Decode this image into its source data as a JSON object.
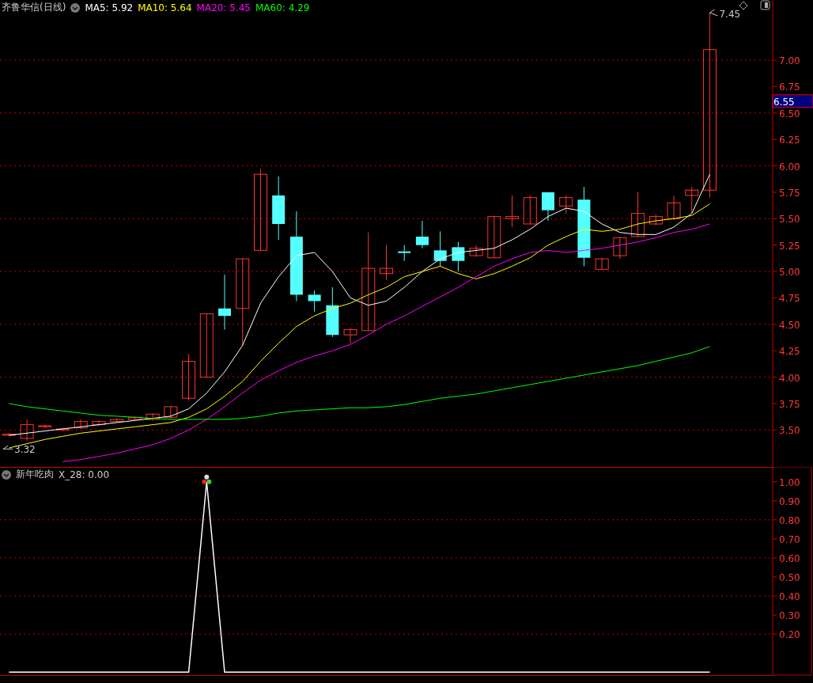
{
  "header": {
    "title": "齐鲁华信(日线)",
    "indicators": [
      {
        "label": "MA5: 5.92"
      },
      {
        "label": "MA10: 5.64"
      },
      {
        "label": "MA20: 5.45"
      },
      {
        "label": "MA60: 4.29"
      }
    ]
  },
  "price_chart": {
    "high_label": "7.45",
    "low_label": "3.32",
    "current_price": "6.55",
    "chart_data": {
      "type": "candlestick",
      "grid": true,
      "ylim": [
        3.15,
        7.57
      ],
      "categories": [
        null,
        null,
        null,
        null,
        null,
        null,
        null,
        null,
        null,
        null,
        null,
        null,
        null,
        null,
        null,
        null,
        null,
        null,
        null,
        null,
        null,
        null,
        null,
        null,
        null,
        null,
        null,
        null,
        null,
        null,
        null,
        null,
        null,
        null,
        null,
        null,
        null,
        null,
        null,
        null,
        null,
        null,
        null
      ],
      "ohlc": [
        [
          3.45,
          3.47,
          3.44,
          3.46
        ],
        [
          3.42,
          3.6,
          3.4,
          3.55
        ],
        [
          3.53,
          3.55,
          3.52,
          3.54
        ],
        [
          3.5,
          3.52,
          3.49,
          3.51
        ],
        [
          3.52,
          3.6,
          3.51,
          3.58
        ],
        [
          3.55,
          3.59,
          3.54,
          3.58
        ],
        [
          3.58,
          3.61,
          3.57,
          3.6
        ],
        [
          3.6,
          3.63,
          3.59,
          3.62
        ],
        [
          3.6,
          3.66,
          3.59,
          3.65
        ],
        [
          3.62,
          3.73,
          3.61,
          3.72
        ],
        [
          3.8,
          4.22,
          3.78,
          4.15
        ],
        [
          4.0,
          4.6,
          4.0,
          4.6
        ],
        [
          4.65,
          4.97,
          4.45,
          4.58
        ],
        [
          4.65,
          5.12,
          4.3,
          5.12
        ],
        [
          5.2,
          5.97,
          5.2,
          5.92
        ],
        [
          5.72,
          5.9,
          5.3,
          5.45
        ],
        [
          5.33,
          5.57,
          4.72,
          4.78
        ],
        [
          4.78,
          4.82,
          4.62,
          4.72
        ],
        [
          4.68,
          4.85,
          4.38,
          4.4
        ],
        [
          4.4,
          4.47,
          4.32,
          4.45
        ],
        [
          4.44,
          5.37,
          4.44,
          5.03
        ],
        [
          4.98,
          5.25,
          4.92,
          5.03
        ],
        [
          5.19,
          5.25,
          5.1,
          5.18
        ],
        [
          5.33,
          5.48,
          5.22,
          5.25
        ],
        [
          5.2,
          5.38,
          5.05,
          5.1
        ],
        [
          5.23,
          5.28,
          5.0,
          5.1
        ],
        [
          5.15,
          5.25,
          5.14,
          5.22
        ],
        [
          5.13,
          5.52,
          5.13,
          5.52
        ],
        [
          5.5,
          5.72,
          5.42,
          5.52
        ],
        [
          5.45,
          5.72,
          5.45,
          5.7
        ],
        [
          5.75,
          5.75,
          5.48,
          5.58
        ],
        [
          5.62,
          5.72,
          5.55,
          5.7
        ],
        [
          5.68,
          5.8,
          5.05,
          5.13
        ],
        [
          5.02,
          5.13,
          5.02,
          5.12
        ],
        [
          5.15,
          5.33,
          5.12,
          5.32
        ],
        [
          5.33,
          5.75,
          5.33,
          5.55
        ],
        [
          5.45,
          5.54,
          5.44,
          5.52
        ],
        [
          5.5,
          5.72,
          5.49,
          5.65
        ],
        [
          5.72,
          5.8,
          5.55,
          5.77
        ],
        [
          5.77,
          7.45,
          5.7,
          7.1
        ],
        null,
        null,
        null
      ],
      "yticks": [
        {
          "value": 7,
          "label": "7.00"
        },
        {
          "value": 6.75,
          "label": "6.75"
        },
        {
          "value": 6.5,
          "label": "6.50"
        },
        {
          "value": 6.25,
          "label": "6.25"
        },
        {
          "value": 6,
          "label": "6.00"
        },
        {
          "value": 5.75,
          "label": "5.75"
        },
        {
          "value": 5.5,
          "label": "5.50"
        },
        {
          "value": 5.25,
          "label": "5.25"
        },
        {
          "value": 5,
          "label": "5.00"
        },
        {
          "value": 4.75,
          "label": "4.75"
        },
        {
          "value": 4.5,
          "label": "4.50"
        },
        {
          "value": 4.25,
          "label": "4.25"
        },
        {
          "value": 4,
          "label": "4.00"
        },
        {
          "value": 3.75,
          "label": "3.75"
        },
        {
          "value": 3.5,
          "label": "3.50"
        }
      ],
      "series": [
        {
          "type": "line",
          "color": "#ffffff",
          "values": [
            3.45,
            3.47,
            3.49,
            3.51,
            3.53,
            3.55,
            3.57,
            3.59,
            3.61,
            3.63,
            3.7,
            3.85,
            4.05,
            4.3,
            4.7,
            4.95,
            5.15,
            5.18,
            5.0,
            4.75,
            4.68,
            4.72,
            4.85,
            5.0,
            5.12,
            5.18,
            5.2,
            5.22,
            5.3,
            5.4,
            5.52,
            5.6,
            5.57,
            5.45,
            5.37,
            5.35,
            5.35,
            5.42,
            5.55,
            5.92,
            null,
            null,
            null
          ]
        },
        {
          "type": "line",
          "color": "#ffff00",
          "values": [
            3.33,
            3.37,
            3.41,
            3.44,
            3.47,
            3.49,
            3.51,
            3.53,
            3.55,
            3.57,
            3.62,
            3.7,
            3.82,
            3.96,
            4.15,
            4.32,
            4.48,
            4.58,
            4.65,
            4.7,
            4.78,
            4.85,
            4.95,
            5.0,
            5.05,
            4.98,
            4.93,
            4.98,
            5.05,
            5.13,
            5.25,
            5.33,
            5.4,
            5.38,
            5.4,
            5.45,
            5.48,
            5.5,
            5.53,
            5.64,
            null,
            null,
            null
          ]
        },
        {
          "type": "line",
          "color": "#ff00ff",
          "values": [
            null,
            null,
            null,
            3.2,
            3.22,
            3.25,
            3.28,
            3.32,
            3.36,
            3.42,
            3.5,
            3.6,
            3.72,
            3.85,
            3.97,
            4.06,
            4.14,
            4.2,
            4.25,
            4.31,
            4.4,
            4.5,
            4.58,
            4.67,
            4.76,
            4.85,
            4.95,
            5.05,
            5.12,
            5.18,
            5.2,
            5.18,
            5.2,
            5.22,
            5.25,
            5.28,
            5.32,
            5.37,
            5.4,
            5.45,
            null,
            null,
            null
          ]
        },
        {
          "type": "line",
          "color": "#00ff00",
          "values": [
            3.75,
            3.72,
            3.7,
            3.68,
            3.66,
            3.64,
            3.63,
            3.62,
            3.61,
            3.6,
            3.6,
            3.6,
            3.6,
            3.61,
            3.63,
            3.66,
            3.68,
            3.69,
            3.7,
            3.71,
            3.71,
            3.72,
            3.74,
            3.77,
            3.8,
            3.82,
            3.84,
            3.87,
            3.9,
            3.93,
            3.96,
            3.99,
            4.02,
            4.05,
            4.08,
            4.11,
            4.15,
            4.19,
            4.23,
            4.29,
            null,
            null,
            null
          ]
        }
      ]
    }
  },
  "indicator_panel": {
    "name": "新年吃肉",
    "reading": "X_28: 0.00",
    "chart_data": {
      "type": "line",
      "grid": true,
      "ylim": [
        -0.02,
        1.078
      ],
      "categories": [
        null,
        null,
        null,
        null,
        null,
        null,
        null,
        null,
        null,
        null,
        null,
        null,
        null,
        null,
        null,
        null,
        null,
        null,
        null,
        null,
        null,
        null,
        null,
        null,
        null,
        null,
        null,
        null,
        null,
        null,
        null,
        null,
        null,
        null,
        null,
        null,
        null,
        null,
        null,
        null,
        null,
        null,
        null
      ],
      "yticks": [
        {
          "value": 1,
          "label": "1.00"
        },
        {
          "value": 0.9,
          "label": "0.90"
        },
        {
          "value": 0.8,
          "label": "0.80"
        },
        {
          "value": 0.7,
          "label": "0.70"
        },
        {
          "value": 0.6,
          "label": "0.60"
        },
        {
          "value": 0.5,
          "label": "0.50"
        },
        {
          "value": 0.4,
          "label": "0.40"
        },
        {
          "value": 0.3,
          "label": "0.30"
        },
        {
          "value": 0.2,
          "label": "0.20"
        }
      ],
      "series": [
        {
          "color": "#ffffff",
          "values": [
            0,
            0,
            0,
            0,
            0,
            0,
            0,
            0,
            0,
            0,
            0,
            1,
            0,
            0,
            0,
            0,
            0,
            0,
            0,
            0,
            0,
            0,
            0,
            0,
            0,
            0,
            0,
            0,
            0,
            0,
            0,
            0,
            0,
            0,
            0,
            0,
            0,
            0,
            0,
            0,
            null,
            null,
            null
          ]
        }
      ]
    }
  }
}
